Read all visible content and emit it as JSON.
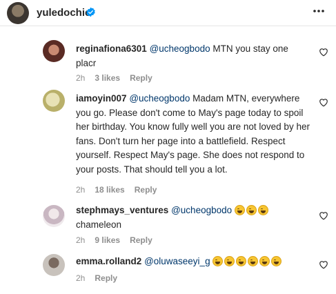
{
  "header": {
    "username": "yuledochie"
  },
  "comments": [
    {
      "username": "reginafiona6301",
      "mention": "@ucheogbodo",
      "text": " MTN you stay one placr",
      "time": "2h",
      "likes": "3 likes",
      "reply": "Reply"
    },
    {
      "username": "iamoyin007",
      "mention": "@ucheogbodo",
      "text": " Madam MTN, everywhere you go. Please don't come to May's page today to spoil her birthday. You know fully well you are not loved by her fans. Don't turn her page into a battlefield. Respect yourself. Respect May's page. She does not respond to your posts. That should tell you a lot.",
      "time": "2h",
      "likes": "18 likes",
      "reply": "Reply"
    },
    {
      "username": "stephmays_ventures",
      "mention": "@ucheogbodo",
      "emoji_count": 3,
      "text": "chameleon",
      "time": "2h",
      "likes": "9 likes",
      "reply": "Reply"
    },
    {
      "username": "emma.rolland2",
      "mention": "@oluwaseeyi_g",
      "emoji_count": 6,
      "time": "2h",
      "reply": "Reply"
    }
  ],
  "colors": {
    "mention": "#00376b",
    "verified": "#0095f6",
    "meta": "#8e8e8e"
  },
  "icons": {
    "verified": "verified-badge-icon",
    "more": "more-options-icon",
    "like": "heart-icon"
  }
}
